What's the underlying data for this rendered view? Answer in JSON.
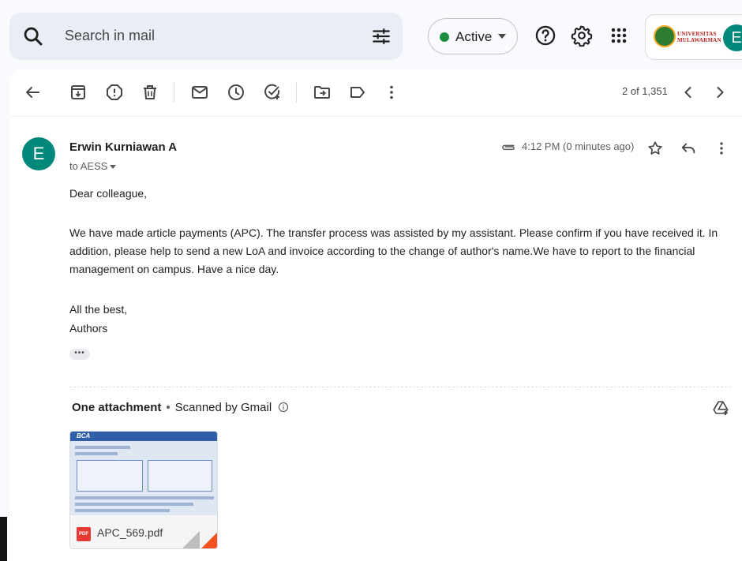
{
  "search": {
    "placeholder": "Search in mail"
  },
  "status": {
    "label": "Active",
    "color": "#1e8e3e"
  },
  "account": {
    "org_line1": "UNIVERSITAS",
    "org_line2": "MULAWARMAN",
    "initial": "E",
    "avatar_color": "#00897b"
  },
  "toolbar": {
    "page_count": "2 of 1,351"
  },
  "message": {
    "sender_initial": "E",
    "sender_name": "Erwin Kurniawan A",
    "to_line": "to AESS",
    "time": "4:12 PM (0 minutes ago)",
    "greeting": "Dear colleague,",
    "paragraph_lines": [
      "We have made article payments (APC). The transfer process was assisted by my assistant. Please confirm if you have received it. In",
      "addition, please help to send a new LoA and invoice according to the change of author's name.We have to report to the financial",
      "management on campus. Have a nice day."
    ],
    "closing": "All the best,",
    "signature": "Authors",
    "more_dots": "•••"
  },
  "attachments": {
    "heading": "One attachment",
    "scan_note": "Scanned by Gmail",
    "file": {
      "name": "APC_569.pdf",
      "type_badge": "PDF",
      "preview_brand": "BCA"
    }
  },
  "icons": [
    "search-icon",
    "filter-icon",
    "help-icon",
    "settings-icon",
    "apps-icon",
    "back-icon",
    "archive-icon",
    "report-spam-icon",
    "delete-icon",
    "mark-unread-icon",
    "snooze-icon",
    "add-task-icon",
    "move-to-icon",
    "label-icon",
    "more-vert-icon",
    "chevron-left-icon",
    "chevron-right-icon",
    "paperclip-icon",
    "star-icon",
    "reply-icon",
    "info-icon",
    "save-to-drive-icon"
  ]
}
